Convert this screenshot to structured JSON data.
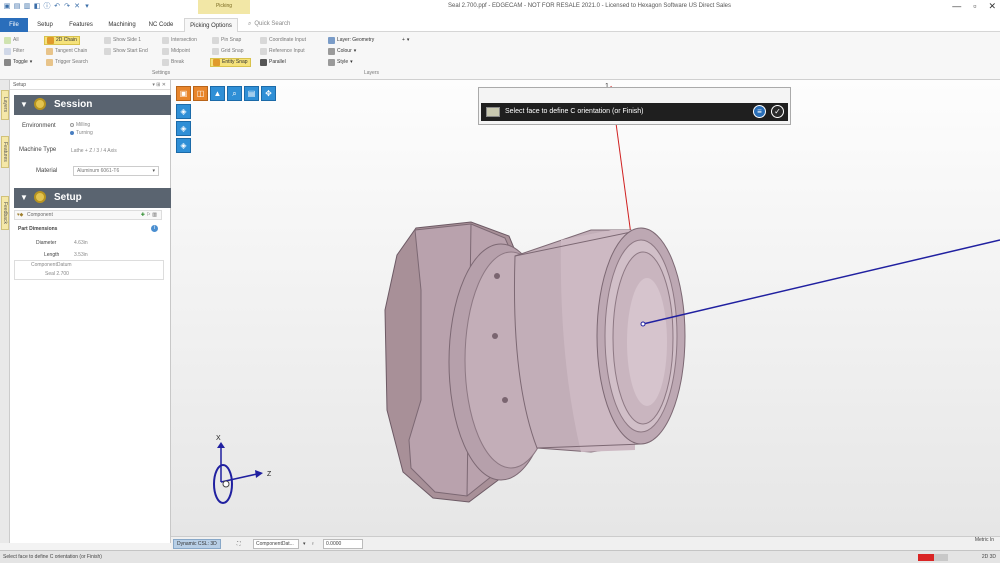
{
  "window": {
    "title": "Seal 2.700.ppf - EDGECAM - NOT FOR RESALE 2021.0 - Licensed to Hexagon Software US Direct Sales",
    "controls": [
      "—",
      "▫",
      "✕"
    ]
  },
  "context_tab": {
    "label": "Picking"
  },
  "tabs": [
    {
      "label": "File"
    },
    {
      "label": "Setup"
    },
    {
      "label": "Features"
    },
    {
      "label": "Machining"
    },
    {
      "label": "NC Code"
    },
    {
      "label": "Picking Options"
    }
  ],
  "search": {
    "placeholder": "Quick Search"
  },
  "ribbon": {
    "col1": [
      "All",
      "Filter",
      "Toggle"
    ],
    "col2": [
      "2D Chain",
      "Tangent Chain",
      "Trigger Search"
    ],
    "col3": [
      "Show Side 1",
      "Show Start End"
    ],
    "col4": [
      "Intersection",
      "Midpoint",
      "Break"
    ],
    "col5": [
      "Pin Snap",
      "Grid Snap",
      "Entity Snap"
    ],
    "col6": [
      "Coordinate Input",
      "Reference Input",
      "Parallel"
    ],
    "col7": [
      "Layer: Geometry",
      "Colour",
      "Style"
    ],
    "group_settings": "Settings",
    "group_layers": "Layers"
  },
  "left_tabs": [
    "Layers",
    "Features",
    "Feedback"
  ],
  "panel": {
    "title": "Setup",
    "session": {
      "header": "Session",
      "environment_label": "Environment",
      "environment_options": [
        "Milling",
        "Turning"
      ],
      "environment_selected": 1,
      "machine_type_label": "Machine Type",
      "machine_type_value": "Lathe + Z / 3 / 4 Axis",
      "material_label": "Material",
      "material_value": "Aluminum 6061-T6"
    },
    "setup": {
      "header": "Setup",
      "component_label": "Component",
      "part_dimensions_label": "Part Dimensions",
      "diameter_label": "Diameter",
      "diameter_value": "4.63in",
      "length_label": "Length",
      "length_value": "3.53in",
      "tree_items": [
        "ComponentDatum",
        "Seal 2.700"
      ]
    }
  },
  "viewport": {
    "prompt": "Select face to define C orientation (or Finish)",
    "axis_labels": {
      "x": "X",
      "z": "Z",
      "pick": "1"
    },
    "tools_row": [
      "▣",
      "◫",
      "▲",
      "⌕",
      "▤",
      "✥"
    ],
    "tools_col": [
      "◈",
      "◈",
      "◈",
      "◈"
    ],
    "colors": {
      "part": "#c8b4c0",
      "part_dark": "#8f7b88",
      "c_axis_line": "#2020a0",
      "pick_line": "#d02020"
    }
  },
  "bottom_bar": {
    "view_tab": "Dynamic CSL: 3D",
    "component_label": "ComponentDat...",
    "value": "0.0000"
  },
  "status": {
    "text": "Select face to define C orientation (or Finish)",
    "units": "Metric In",
    "right": "2D  3D"
  }
}
